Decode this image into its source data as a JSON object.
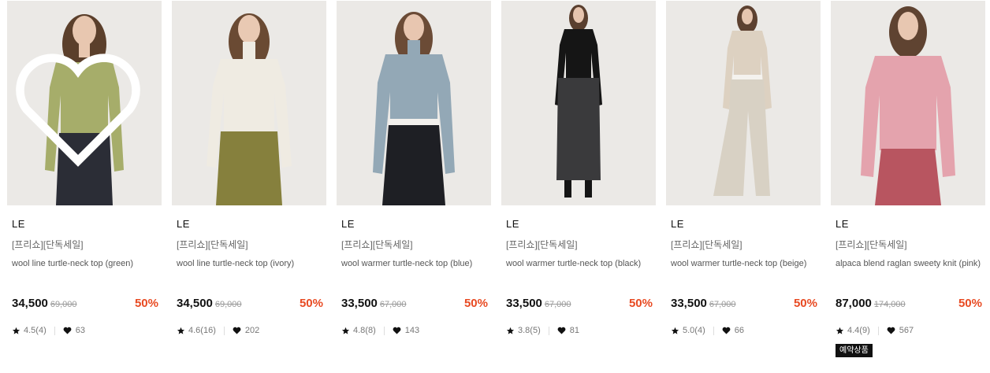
{
  "products": [
    {
      "brand": "LE",
      "tag": "[프리쇼][단독세일]",
      "name": "wool line turtle-neck top (green)",
      "price": "34,500",
      "original_price": "69,000",
      "discount": "50%",
      "rating": "4.5(4)",
      "likes": "63",
      "top_color": "#a6ad6a",
      "bottom_color": "#2b2d36"
    },
    {
      "brand": "LE",
      "tag": "[프리쇼][단독세일]",
      "name": "wool line turtle-neck top (ivory)",
      "price": "34,500",
      "original_price": "69,000",
      "discount": "50%",
      "rating": "4.6(16)",
      "likes": "202",
      "top_color": "#efebe2",
      "bottom_color": "#86803d"
    },
    {
      "brand": "LE",
      "tag": "[프리쇼][단독세일]",
      "name": "wool warmer turtle-neck top (blue)",
      "price": "33,500",
      "original_price": "67,000",
      "discount": "50%",
      "rating": "4.8(8)",
      "likes": "143",
      "top_color": "#93a8b6",
      "bottom_color": "#1e1f24"
    },
    {
      "brand": "LE",
      "tag": "[프리쇼][단독세일]",
      "name": "wool warmer turtle-neck top (black)",
      "price": "33,500",
      "original_price": "67,000",
      "discount": "50%",
      "rating": "3.8(5)",
      "likes": "81",
      "top_color": "#151515",
      "bottom_color": "#3a3a3c"
    },
    {
      "brand": "LE",
      "tag": "[프리쇼][단독세일]",
      "name": "wool warmer turtle-neck top (beige)",
      "price": "33,500",
      "original_price": "67,000",
      "discount": "50%",
      "rating": "5.0(4)",
      "likes": "66",
      "top_color": "#ddd1c1",
      "bottom_color": "#d8d1c4"
    },
    {
      "brand": "LE",
      "tag": "[프리쇼][단독세일]",
      "name": "alpaca blend raglan sweety knit (pink)",
      "price": "87,000",
      "original_price": "174,000",
      "discount": "50%",
      "rating": "4.4(9)",
      "likes": "567",
      "badge": "예약상품",
      "top_color": "#e4a3ad",
      "bottom_color": "#b85560"
    }
  ],
  "colors": {
    "discount": "#e84a22",
    "photo_background": "#ebe9e6",
    "badge_background": "#111111"
  },
  "icons": {
    "rating": "star-icon",
    "likes": "heart-icon",
    "wishlist": "heart-outline-icon"
  }
}
